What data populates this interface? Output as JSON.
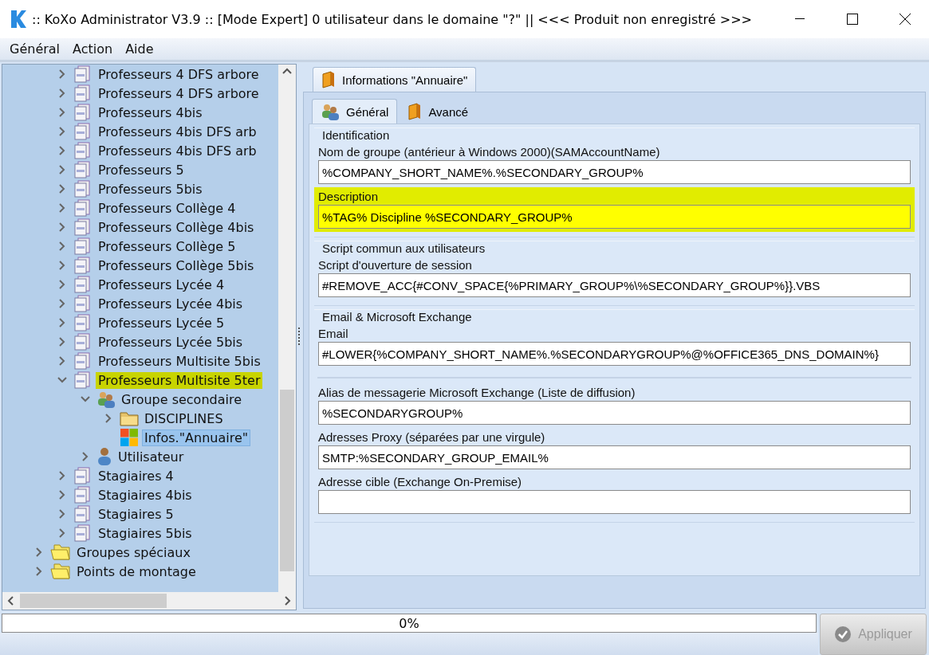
{
  "window": {
    "title": ":: KoXo Administrator V3.9 :: [Mode Expert] 0 utilisateur dans le domaine \"?\" || <<< Produit non enregistré >>>"
  },
  "menu": [
    "Général",
    "Action",
    "Aide"
  ],
  "tree": {
    "items": [
      {
        "children": [
          {
            "label": "Professeurs 4 DFS arbore",
            "kind": "groupdoc",
            "expanded": false,
            "selected": false,
            "highlighted": false
          },
          {
            "label": "Professeurs 4 DFS arbore",
            "kind": "groupdoc",
            "expanded": false,
            "selected": false,
            "highlighted": false
          },
          {
            "label": "Professeurs 4bis",
            "kind": "groupdoc",
            "expanded": false,
            "selected": false,
            "highlighted": false
          },
          {
            "label": "Professeurs 4bis DFS arb",
            "kind": "groupdoc",
            "expanded": false,
            "selected": false,
            "highlighted": false
          },
          {
            "label": "Professeurs 4bis DFS arb",
            "kind": "groupdoc",
            "expanded": false,
            "selected": false,
            "highlighted": false
          },
          {
            "label": "Professeurs 5",
            "kind": "groupdoc",
            "expanded": false,
            "selected": false,
            "highlighted": false
          },
          {
            "label": "Professeurs 5bis",
            "kind": "groupdoc",
            "expanded": false,
            "selected": false,
            "highlighted": false
          },
          {
            "label": "Professeurs Collège 4",
            "kind": "groupdoc",
            "expanded": false,
            "selected": false,
            "highlighted": false
          },
          {
            "label": "Professeurs Collège 4bis",
            "kind": "groupdoc",
            "expanded": false,
            "selected": false,
            "highlighted": false
          },
          {
            "label": "Professeurs Collège 5",
            "kind": "groupdoc",
            "expanded": false,
            "selected": false,
            "highlighted": false
          },
          {
            "label": "Professeurs Collège 5bis",
            "kind": "groupdoc",
            "expanded": false,
            "selected": false,
            "highlighted": false
          },
          {
            "label": "Professeurs Lycée 4",
            "kind": "groupdoc",
            "expanded": false,
            "selected": false,
            "highlighted": false
          },
          {
            "label": "Professeurs Lycée 4bis",
            "kind": "groupdoc",
            "expanded": false,
            "selected": false,
            "highlighted": false
          },
          {
            "label": "Professeurs Lycée 5",
            "kind": "groupdoc",
            "expanded": false,
            "selected": false,
            "highlighted": false
          },
          {
            "label": "Professeurs Lycée 5bis",
            "kind": "groupdoc",
            "expanded": false,
            "selected": false,
            "highlighted": false
          },
          {
            "label": "Professeurs Multisite 5bis",
            "kind": "groupdoc",
            "expanded": false,
            "selected": false,
            "highlighted": false
          },
          {
            "label": "Professeurs Multisite 5ter",
            "kind": "groupdoc",
            "expanded": true,
            "selected": false,
            "highlighted": true,
            "children": [
              {
                "label": "Groupe secondaire",
                "kind": "group",
                "expanded": true,
                "selected": false,
                "highlighted": false,
                "children": [
                  {
                    "label": "DISCIPLINES",
                    "kind": "folder",
                    "expanded": false,
                    "selected": false,
                    "highlighted": false
                  },
                  {
                    "label": "Infos.\"Annuaire\"",
                    "kind": "windows",
                    "selected": true,
                    "highlighted": false
                  }
                ]
              },
              {
                "label": "Utilisateur",
                "kind": "user",
                "expanded": false,
                "selected": false,
                "highlighted": false
              }
            ]
          },
          {
            "label": "Stagiaires 4",
            "kind": "groupdoc",
            "expanded": false,
            "selected": false,
            "highlighted": false
          },
          {
            "label": "Stagiaires 4bis",
            "kind": "groupdoc",
            "expanded": false,
            "selected": false,
            "highlighted": false
          },
          {
            "label": "Stagiaires 5",
            "kind": "groupdoc",
            "expanded": false,
            "selected": false,
            "highlighted": false
          },
          {
            "label": "Stagiaires 5bis",
            "kind": "groupdoc",
            "expanded": false,
            "selected": false,
            "highlighted": false
          }
        ]
      },
      {
        "label": "Groupes spéciaux",
        "kind": "yfolder",
        "expanded": false,
        "selected": false,
        "highlighted": false
      },
      {
        "label": "Points de montage",
        "kind": "yfolder",
        "expanded": false,
        "selected": false,
        "highlighted": false
      }
    ]
  },
  "outer_tab": {
    "label": "Informations \"Annuaire\""
  },
  "tabs": [
    {
      "label": "Général",
      "kind": "group",
      "selected": true
    },
    {
      "label": "Avancé",
      "kind": "book",
      "selected": false
    }
  ],
  "sections": [
    {
      "title": "Identification",
      "fields": [
        {
          "label": "Nom de groupe (antérieur à Windows 2000)(SAMAccountName)",
          "value": "%COMPANY_SHORT_NAME%.%SECONDARY_GROUP%",
          "highlighted": false
        },
        {
          "label": "Description",
          "value": "%TAG% Discipline %SECONDARY_GROUP%",
          "highlighted": true
        }
      ]
    },
    {
      "title": "Script commun aux utilisateurs",
      "fields": [
        {
          "label": "Script d'ouverture de session",
          "value": "#REMOVE_ACC{#CONV_SPACE{%PRIMARY_GROUP%\\%SECONDARY_GROUP%}}.VBS",
          "highlighted": false
        }
      ]
    },
    {
      "title": "Email & Microsoft Exchange",
      "fields": [
        {
          "label": "Email",
          "value": "#LOWER{%COMPANY_SHORT_NAME%.%SECONDARYGROUP%@%OFFICE365_DNS_DOMAIN%}",
          "highlighted": false
        },
        {
          "kind": "divider"
        },
        {
          "label": "Alias de messagerie Microsoft Exchange (Liste de diffusion)",
          "value": "%SECONDARYGROUP%",
          "highlighted": false
        },
        {
          "label": "Adresses Proxy (séparées par une virgule)",
          "value": "SMTP:%SECONDARY_GROUP_EMAIL%",
          "highlighted": false
        },
        {
          "label": "Adresse cible (Exchange On-Premise)",
          "highlighted": false
        }
      ]
    }
  ],
  "progress": {
    "text": "0%",
    "level": 0
  },
  "apply_button": {
    "label": "Appliquer",
    "disabled": true
  }
}
